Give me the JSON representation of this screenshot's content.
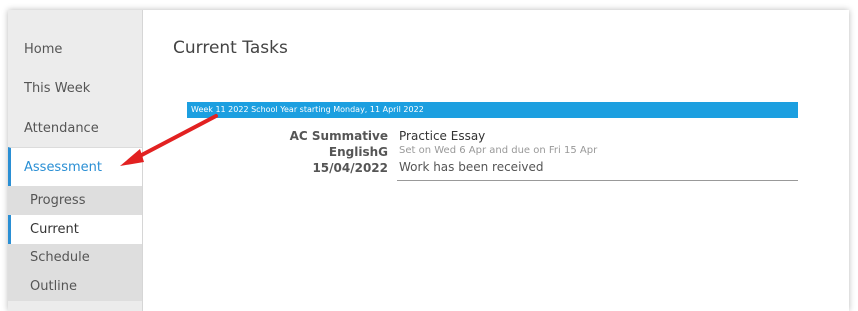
{
  "sidebar": {
    "items": [
      {
        "label": "Home"
      },
      {
        "label": "This Week"
      },
      {
        "label": "Attendance"
      },
      {
        "label": "Assessment"
      }
    ],
    "subitems": [
      {
        "label": "Progress"
      },
      {
        "label": "Current"
      },
      {
        "label": "Schedule"
      },
      {
        "label": "Outline"
      }
    ]
  },
  "main": {
    "title": "Current Tasks",
    "week_banner": "Week 11 2022 School Year starting Monday, 11 April 2022",
    "task": {
      "type": "AC Summative",
      "subject": "EnglishG",
      "date": "15/04/2022",
      "name": "Practice Essay",
      "dates": "Set on Wed 6 Apr and due on Fri 15 Apr",
      "status": "Work has been received"
    }
  },
  "colors": {
    "accent": "#2a8fd4",
    "banner": "#1c9fe0",
    "annotation_arrow": "#e22121"
  }
}
